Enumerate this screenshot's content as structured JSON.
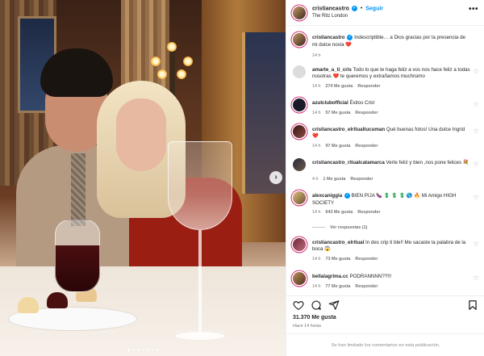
{
  "post": {
    "username": "cristiancastro",
    "follow_label": "Seguir",
    "location": "The Ritz London",
    "more_label": "•••"
  },
  "comments": [
    {
      "user": "cristiancastro",
      "text": "Indescriptible… a Dios gracias por la presencia de mi dulce novia",
      "emoji": "❤️",
      "time": "14 h",
      "likes": "",
      "reply": ""
    },
    {
      "user": "amarte_a_ti_cris",
      "text": "Todo lo que te haga feliz a vos nos hace feliz a todas nosotras",
      "emoji2": "❤️",
      "text2": " te queremos y extrañamos muchísimo",
      "time": "14 h",
      "likes": "274 Me gusta",
      "reply": "Responder"
    },
    {
      "user": "azulclubofficial",
      "text": "Éxitos Cris!",
      "time": "14 h",
      "likes": "57 Me gusta",
      "reply": "Responder"
    },
    {
      "user": "cristiancastro_elritualtucuman",
      "text": "Qué buenas fotos! Una dulce Ingrid",
      "emoji": "❤️",
      "time": "14 h",
      "likes": "97 Me gusta",
      "reply": "Responder"
    },
    {
      "user": "cristiancastro_ritualcatamarca",
      "text": "Verte feliz y bien ,nos pone felices",
      "emoji": "💐",
      "time": "4 h",
      "likes": "1 Me gusta",
      "reply": "Responder"
    },
    {
      "user": "alexcaniggia",
      "text": "BIEN PIJA 🍆 💲 💲 💲 🌎 🔥 Mi Amigo HIGH SOCIETY",
      "time": "14 h",
      "likes": "643 Me gusta",
      "reply": "Responder",
      "view_replies": "Ver respuestas (1)"
    },
    {
      "user": "cristiancastro_elritual",
      "text": "In des crip ti ble!! Me sacaste la palabra de la boca",
      "emoji": "😱",
      "time": "14 h",
      "likes": "73 Me gusta",
      "reply": "Responder"
    },
    {
      "user": "bellalagrima.cc",
      "text": "PODRANNNN??!!!",
      "time": "14 h",
      "likes": "77 Me gusta",
      "reply": "Responder"
    }
  ],
  "likes_total": "31.370 Me gusta",
  "time_ago": "Hace 14 horas",
  "comments_disabled": "Se han limitado los comentarios en esta publicación.",
  "icons": {
    "heart": "heart-icon",
    "comment": "comment-icon",
    "share": "share-icon",
    "save": "bookmark-icon",
    "verified": "verified-badge-icon",
    "next": "chevron-right-icon"
  },
  "colors": {
    "link_blue": "#0095f6",
    "red_heart": "#ed4956",
    "meta_gray": "#737373"
  }
}
